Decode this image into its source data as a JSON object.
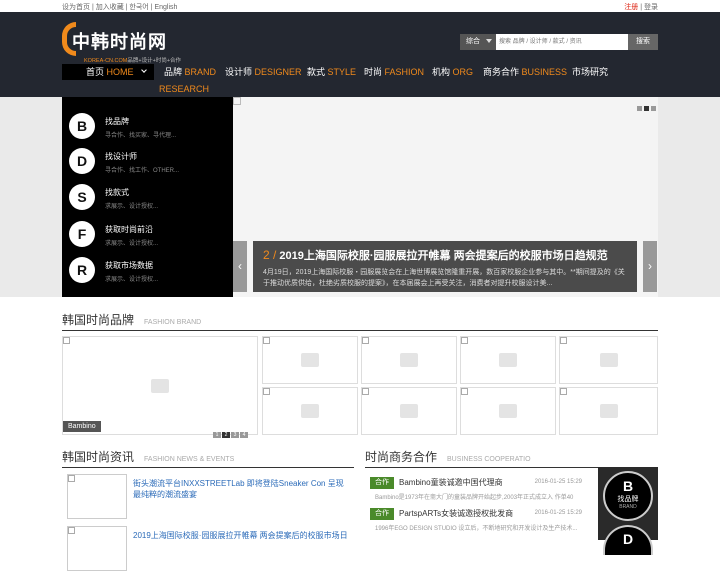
{
  "topbar": {
    "left_text": "设为首页 | 加入收藏 | 한국어 | English",
    "register": "注册",
    "sep": " | ",
    "login": "登录"
  },
  "logo": {
    "cn": "中韩时尚网",
    "domain": "KOREA-CN.COM",
    "slogan": "品牌+设计+时尚+合作"
  },
  "search": {
    "category": "综合",
    "placeholder": "搜索 品牌 / 设计师 / 款式 / 资讯",
    "button": "搜索"
  },
  "nav": [
    {
      "cn": "首页",
      "en": "HOME"
    },
    {
      "cn": "品牌",
      "en": "BRAND"
    },
    {
      "cn": "设计师",
      "en": "DESIGNER"
    },
    {
      "cn": "款式",
      "en": "STYLE"
    },
    {
      "cn": "时尚",
      "en": "FASHION"
    },
    {
      "cn": "机构",
      "en": "ORG"
    },
    {
      "cn": "商务合作",
      "en": "BUSINESS"
    },
    {
      "cn": "市场研究",
      "en": "RESEARCH"
    }
  ],
  "dropdown": [
    {
      "letter": "B",
      "title": "找品牌",
      "desc": "寻合作、找买家、寻代理..."
    },
    {
      "letter": "D",
      "title": "找设计师",
      "desc": "寻合作、找工作、OTHER..."
    },
    {
      "letter": "S",
      "title": "找款式",
      "desc": "求展示、设计授权..."
    },
    {
      "letter": "F",
      "title": "获取时尚前沿",
      "desc": "求展示、设计授权..."
    },
    {
      "letter": "R",
      "title": "获取市场数据",
      "desc": "求展示、设计授权..."
    }
  ],
  "hero": {
    "num": "2 /",
    "title": "2019上海国际校服·园服展拉开帷幕 两会提案后的校服市场日趋规范",
    "desc": "4月19日，2019上海国际校服・园服展览会在上海世博展览馆隆重开展，数百家校服企业参与其中。**期间提及的《关于推动优质供给，杜绝劣质校服的提案》，在本届展会上再受关注，消费者对提升校服设计美..."
  },
  "brand_section": {
    "title": "韩国时尚品牌",
    "title_en": "FASHION BRAND",
    "featured_label": "Bambino",
    "pager": [
      "1",
      "2",
      "3",
      "4"
    ]
  },
  "news_section": {
    "title": "韩国时尚资讯",
    "title_en": "FASHION NEWS & EVENTS",
    "items": [
      {
        "title": "街头潮流平台INXXSTREETLab 即将登陆Sneaker Con 呈现最纯粹的潮流盛宴"
      },
      {
        "title": "2019上海国际校服·园服展拉开帷幕 两会提案后的校服市场日"
      }
    ]
  },
  "biz_section": {
    "title": "时尚商务合作",
    "title_en": "BUSINESS COOPERATIO",
    "items": [
      {
        "tag": "合作",
        "title": "Bambino童装诚邀中国代理商",
        "date": "2016-01-25 15:29",
        "desc": "Bambino是1973年在斋大门的童装品牌开始起步,2003年正式成立入 作单40"
      },
      {
        "tag": "合作",
        "title": "PartspARTs女装诚邀授权批发商",
        "date": "2016-01-25 15:29",
        "desc": "1996年EGO DESIGN STUDIO 设立后，不断地研究和开发设计及生产技术..."
      }
    ],
    "side": {
      "letter": "B",
      "title": "找品牌",
      "en": "BRAND",
      "letter2": "D"
    }
  }
}
